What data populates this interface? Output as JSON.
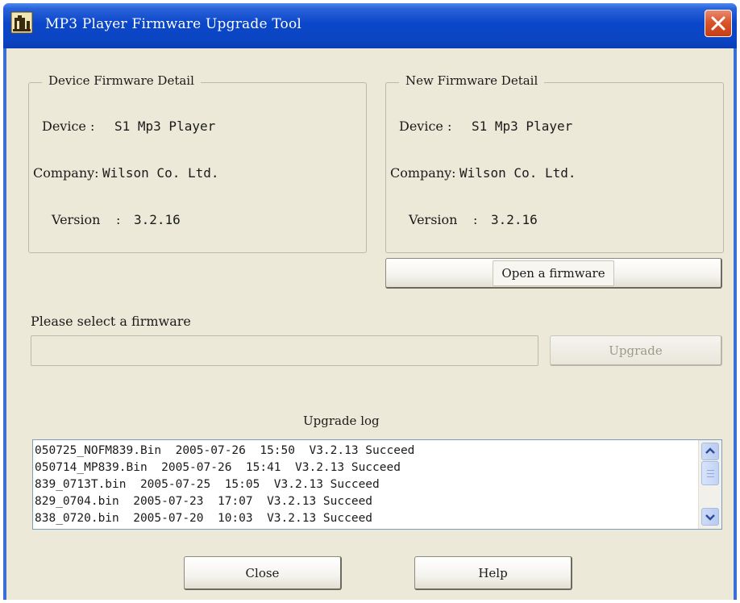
{
  "window": {
    "title": "MP3 Player  Firmware Upgrade Tool",
    "close_icon": "close-icon"
  },
  "device_firmware": {
    "legend": "Device Firmware Detail",
    "device_label": "Device :",
    "device_value": "S1 Mp3 Player",
    "company_label": "Company:",
    "company_value": "Wilson Co. Ltd.",
    "version_label": "Version",
    "version_sep": ":",
    "version_value": "3.2.16"
  },
  "new_firmware": {
    "legend": "New Firmware Detail",
    "device_label": "Device :",
    "device_value": "S1 Mp3 Player",
    "company_label": "Company:",
    "company_value": "Wilson Co. Ltd.",
    "version_label": "Version",
    "version_sep": ":",
    "version_value": "3.2.16"
  },
  "open_button": "Open a firmware",
  "select_label": "Please select a  firmware",
  "firmware_path": "",
  "upgrade_button": "Upgrade",
  "log_title": "Upgrade log",
  "log_lines": [
    "050725_NOFM839.Bin  2005-07-26  15:50  V3.2.13 Succeed",
    "050714_MP839.Bin  2005-07-26  15:41  V3.2.13 Succeed",
    "839_0713T.bin  2005-07-25  15:05  V3.2.13 Succeed",
    "829_0704.bin  2005-07-23  17:07  V3.2.13 Succeed",
    "838_0720.bin  2005-07-20  10:03  V3.2.13 Succeed"
  ],
  "close_button": "Close",
  "help_button": "Help",
  "colors": {
    "titlebar": "#0a46c9",
    "client": "#ece9d8",
    "close_red": "#d9542c"
  }
}
